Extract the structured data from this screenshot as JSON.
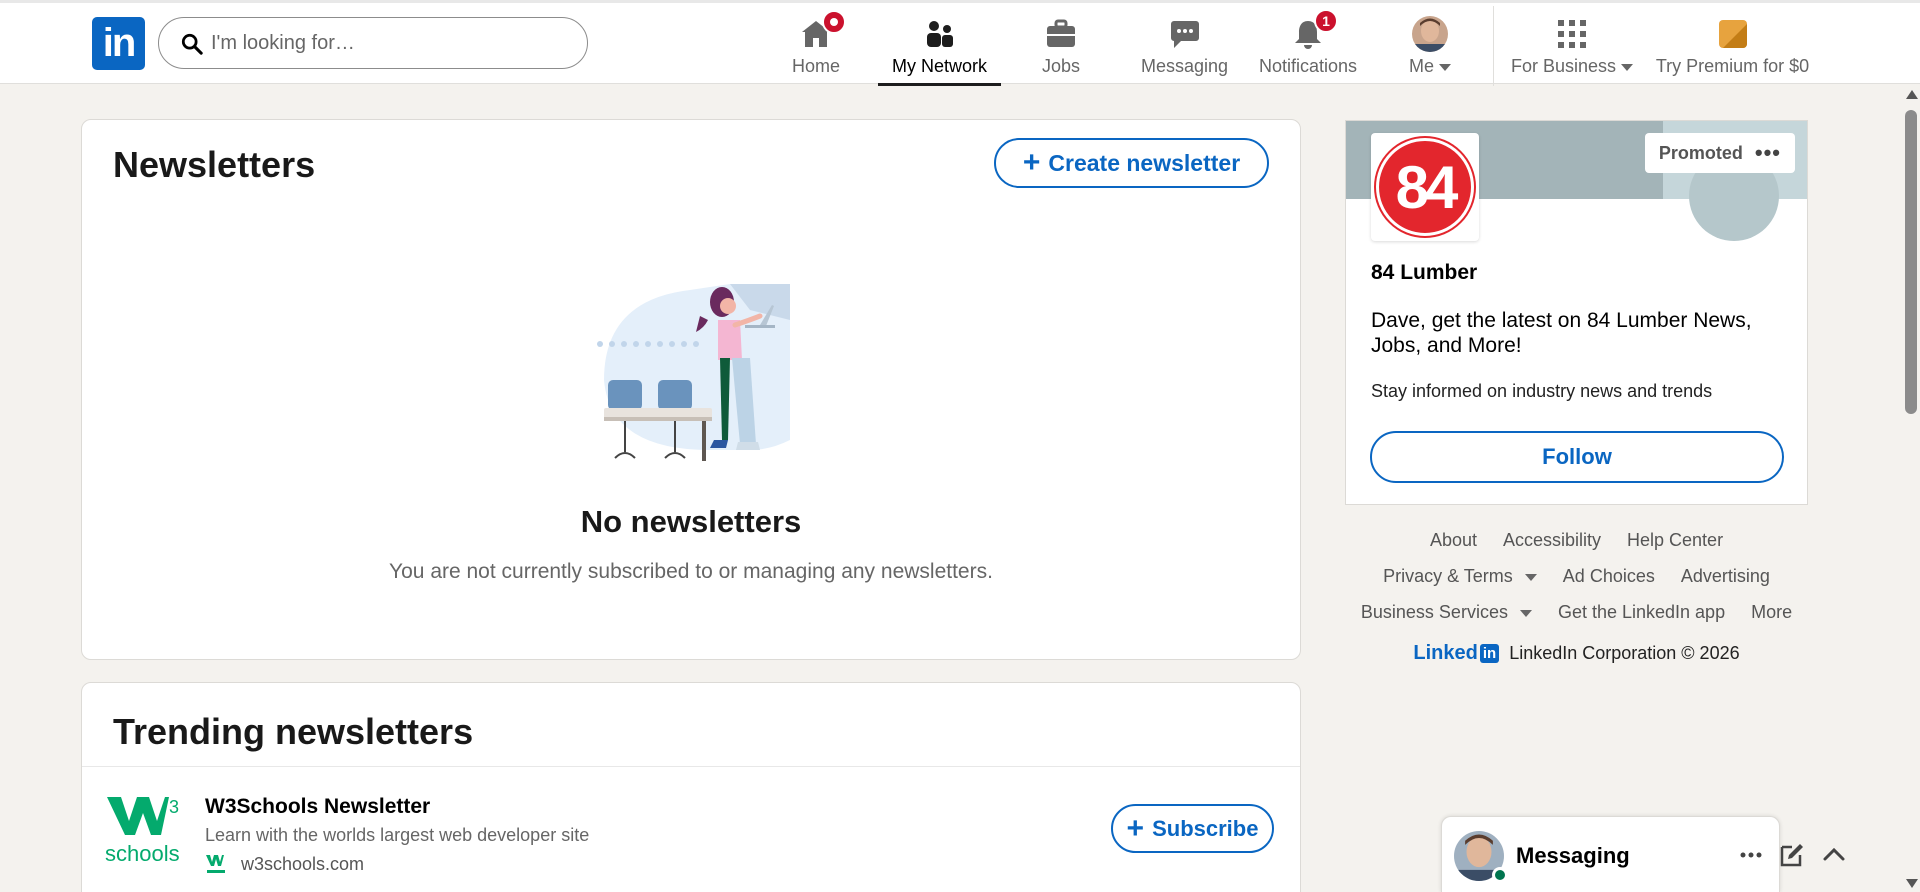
{
  "nav": {
    "logo_text": "in",
    "search_placeholder": "I'm looking for…",
    "items": [
      {
        "label": "Home",
        "icon": "home-icon",
        "badge": ""
      },
      {
        "label": "My Network",
        "icon": "network-icon",
        "badge": ""
      },
      {
        "label": "Jobs",
        "icon": "briefcase-icon",
        "badge": ""
      },
      {
        "label": "Messaging",
        "icon": "messaging-icon",
        "badge": ""
      },
      {
        "label": "Notifications",
        "icon": "bell-icon",
        "badge": "1"
      },
      {
        "label": "Me",
        "icon": "avatar",
        "badge": ""
      },
      {
        "label": "For Business",
        "icon": "grid-icon",
        "badge": ""
      },
      {
        "label": "Try Premium for $0",
        "icon": "premium-icon",
        "badge": ""
      }
    ]
  },
  "newsletters": {
    "title": "Newsletters",
    "create_button": "Create newsletter",
    "empty_title": "No newsletters",
    "empty_subtitle": "You are not currently subscribed to or managing any newsletters."
  },
  "trending": {
    "title": "Trending newsletters",
    "items": [
      {
        "name": "W3Schools Newsletter",
        "description": "Learn with the worlds largest web developer site",
        "site": "w3schools.com",
        "button": "Subscribe"
      }
    ]
  },
  "ad": {
    "promoted_label": "Promoted",
    "logo_text": "84",
    "company": "84 Lumber",
    "headline": "Dave, get the latest on 84 Lumber News, Jobs, and More!",
    "subtext": "Stay informed on industry news and trends",
    "button": "Follow"
  },
  "footer": {
    "row1": [
      "About",
      "Accessibility",
      "Help Center"
    ],
    "row2": [
      "Privacy & Terms",
      "Ad Choices",
      "Advertising"
    ],
    "row3": [
      "Business Services",
      "Get the LinkedIn app",
      "More"
    ],
    "brand_word": "Linked",
    "brand_in": "in",
    "copyright": "LinkedIn Corporation © 2026"
  },
  "messaging_dock": {
    "title": "Messaging"
  },
  "colors": {
    "brand": "#0a66c2",
    "badge": "#cb112d",
    "background": "#f4f2ee",
    "online": "#01754f"
  }
}
